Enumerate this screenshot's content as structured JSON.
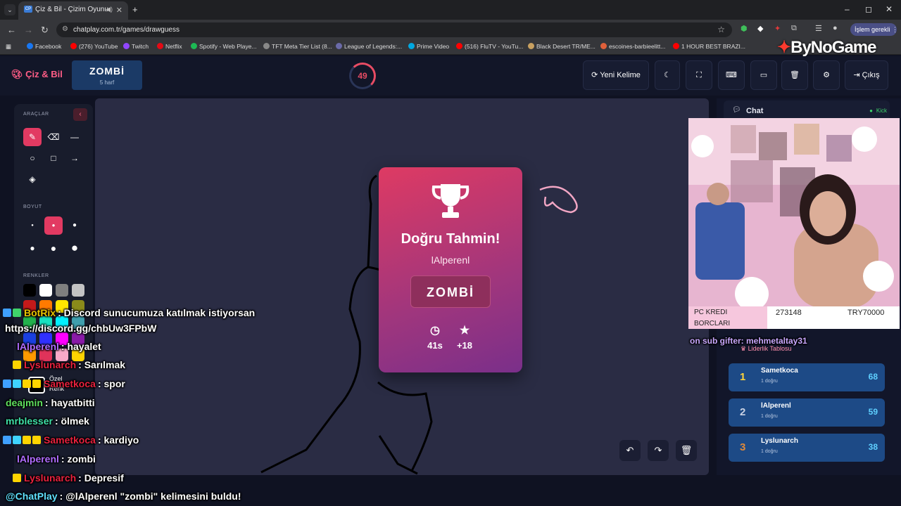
{
  "browser": {
    "tab_title": "Çiz & Bil - Çizim Oyunu",
    "tab_favicon": "CP",
    "url": "chatplay.com.tr/games/drawguess",
    "profile_label": "İşlem gerekli",
    "bookmarks": [
      "Facebook",
      "(276) YouTube",
      "Twitch",
      "Netflix",
      "Spotify - Web Playe...",
      "TFT Meta Tier List (8...",
      "League of Legends:...",
      "Prime Video",
      "(516) FluTV - YouTu...",
      "Black Desert TR/ME...",
      "escoines-barbieelitt...",
      "1 HOUR BEST BRAZI..."
    ]
  },
  "overlay_logo": {
    "text": "ByNoGame"
  },
  "app": {
    "brand": "Çiz & Bil",
    "word": "ZOMBİ",
    "word_hint": "5 harf",
    "timer": "49",
    "actions": {
      "new_word": "Yeni Kelime",
      "exit": "Çıkış"
    }
  },
  "tools": {
    "tools_label": "ARAÇLAR",
    "size_label": "BOYUT",
    "colors_label": "RENKLER",
    "custom_label": "Özel",
    "custom_label2": "Renk",
    "colors": [
      "#000000",
      "#ffffff",
      "#7f7f7f",
      "#c3c3c3",
      "#c41a1a",
      "#ff7a00",
      "#ffe600",
      "#8a8a1a",
      "#22b14c",
      "#18e0c0",
      "#00f0ff",
      "#3f9fae",
      "#1a3fe0",
      "#3030ff",
      "#ff00ff",
      "#8a1aa8",
      "#ff9a00",
      "#e0335a",
      "#f7a9c8",
      "#ffd400"
    ]
  },
  "popup": {
    "title": "Doğru Tahmin!",
    "winner": "lAlperenl",
    "answer": "ZOMBİ",
    "time": "41s",
    "points": "+18"
  },
  "chat": {
    "title": "Chat",
    "source": "Kick"
  },
  "webcam": {
    "label1": "PC KREDI",
    "label2": "BORCLARI",
    "amount": "273148",
    "target": "TRY70000",
    "ticker": "on sub gifter: mehmetaltay31"
  },
  "leaderboard": {
    "title": "Liderlik Tablosu",
    "entries": [
      {
        "rank": "1",
        "name": "Sametkoca",
        "sub": "1 doğru",
        "points": "68"
      },
      {
        "rank": "2",
        "name": "lAlperenl",
        "sub": "1 doğru",
        "points": "59"
      },
      {
        "rank": "3",
        "name": "Lyslunarch",
        "sub": "1 doğru",
        "points": "38"
      }
    ]
  },
  "overlay_chat": [
    {
      "user": "BotRix",
      "msg": ": Discord sunucumuza katılmak istiyorsan",
      "color": "#e8c400"
    },
    {
      "user": "",
      "msg": "https://discord.gg/chbUw3FPbW",
      "color": "#ffffff"
    },
    {
      "user": "lAlperenl",
      "msg": ": hayalet",
      "color": "#b06cff"
    },
    {
      "user": "Lyslunarch",
      "msg": ": Sarılmak",
      "color": "#e8213e"
    },
    {
      "user": "Sametkoca",
      "msg": ": spor",
      "color": "#e8213e"
    },
    {
      "user": "deajmin",
      "msg": ": hayatbitti",
      "color": "#5fe05f"
    },
    {
      "user": "mrblesser",
      "msg": ": ölmek",
      "color": "#3fe0a8"
    },
    {
      "user": "Sametkoca",
      "msg": ": kardiyo",
      "color": "#e8213e"
    },
    {
      "user": "lAlperenl",
      "msg": ": zombi",
      "color": "#b06cff"
    },
    {
      "user": "Lyslunarch",
      "msg": ": Depresif",
      "color": "#e8213e"
    },
    {
      "user": "@ChatPlay",
      "msg": ": @lAlperenl \"zombi\" kelimesini buldu!",
      "color": "#5fe0ff"
    }
  ]
}
